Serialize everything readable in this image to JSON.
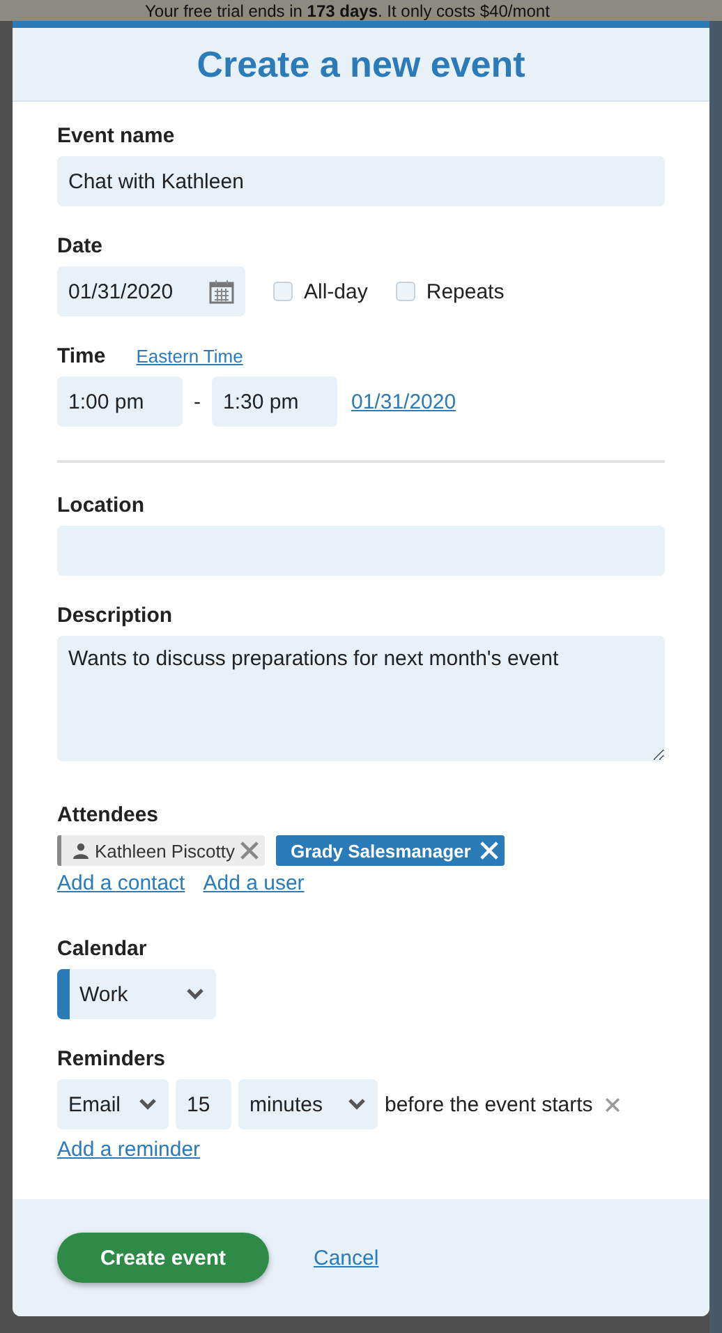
{
  "banner": {
    "text": "Your free trial ends in **173 days**. It only costs $40/mont"
  },
  "dialog": {
    "title": "Create a new event"
  },
  "event_name": {
    "label": "Event name",
    "value": "Chat with Kathleen"
  },
  "date": {
    "label": "Date",
    "value": "01/31/2020"
  },
  "options": [
    {
      "label": "All-day",
      "checked": false
    },
    {
      "label": "Repeats",
      "checked": false
    }
  ],
  "time": {
    "label": "Time",
    "timezone_link": "Eastern Time",
    "start": "1:00 pm",
    "separator": "-",
    "end": "1:30 pm",
    "end_date_link": "01/31/2020"
  },
  "location": {
    "label": "Location"
  },
  "description": {
    "label": "Description",
    "value": "Wants to discuss preparations for next month's event"
  },
  "attendees": {
    "label": "Attendees",
    "items": [
      {
        "name": "Kathleen Piscotty",
        "kind": "contact"
      },
      {
        "name": "Grady Salesmanager",
        "kind": "user"
      }
    ],
    "links": [
      "Add a contact",
      "Add a user"
    ]
  },
  "calendar": {
    "label": "Calendar",
    "value": "Work"
  },
  "reminders": {
    "label": "Reminders",
    "items": [
      {
        "method": "Email",
        "amount": "15",
        "unit": "minutes",
        "suffix": "before the event starts"
      }
    ],
    "add_link": "Add a reminder"
  },
  "buttons": {
    "primary": "Create event",
    "cancel": "Cancel"
  }
}
